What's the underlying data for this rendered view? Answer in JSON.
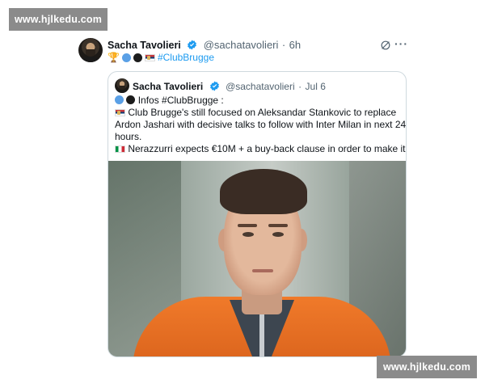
{
  "watermark": {
    "top": "www.hjlkedu.com",
    "bottom": "www.hjlkedu.com"
  },
  "tweet": {
    "author_name": "Sacha Tavolieri",
    "author_handle": "@sachatavolieri",
    "separator": "·",
    "time": "6h",
    "hashtag": "#ClubBrugge",
    "icons": [
      "trophy-icon",
      "blue-circle",
      "black-circle",
      "serbia-flag"
    ],
    "actions": {
      "grok_icon": "grok-icon",
      "more_label": "···"
    }
  },
  "quote": {
    "author_name": "Sacha Tavolieri",
    "author_handle": "@sachatavolieri",
    "separator": "·",
    "time": "Jul 6",
    "lines": [
      "Infos #ClubBrugge :",
      "Club Brugge's still focused on Aleksandar Stankovic to replace",
      "Ardon Jashari with decisive talks to follow with Inter Milan in next 24",
      "hours.",
      "Nerazzurri expects €10M + a buy-back clause in order to make it ..."
    ]
  },
  "colors": {
    "link": "#1d9bf0",
    "verified": "#1d9bf0",
    "jacket": "#f07a2a"
  }
}
